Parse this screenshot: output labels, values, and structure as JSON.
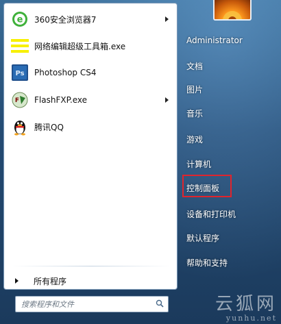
{
  "programs": [
    {
      "label": "360安全浏览器7",
      "icon": "360-browser-icon",
      "has_submenu": true
    },
    {
      "label": "网络编辑超级工具箱.exe",
      "icon": "exe-icon",
      "has_submenu": false
    },
    {
      "label": "Photoshop CS4",
      "icon": "photoshop-icon",
      "has_submenu": false
    },
    {
      "label": "FlashFXP.exe",
      "icon": "flashfxp-icon",
      "has_submenu": true
    },
    {
      "label": "腾讯QQ",
      "icon": "qq-penguin-icon",
      "has_submenu": false
    }
  ],
  "all_programs": {
    "label": "所有程序"
  },
  "search": {
    "placeholder": "搜索程序和文件"
  },
  "right_panel": {
    "user_name": "Administrator",
    "items": [
      {
        "label": "文档"
      },
      {
        "label": "图片"
      },
      {
        "label": "音乐"
      },
      {
        "label": "游戏"
      },
      {
        "label": "计算机"
      },
      {
        "label": "控制面板",
        "highlighted": true
      },
      {
        "label": "设备和打印机"
      },
      {
        "label": "默认程序"
      },
      {
        "label": "帮助和支持"
      }
    ]
  },
  "watermark": {
    "text": "云狐网",
    "url": "yunhu.net"
  },
  "colors": {
    "highlight_border": "#e1242c"
  }
}
